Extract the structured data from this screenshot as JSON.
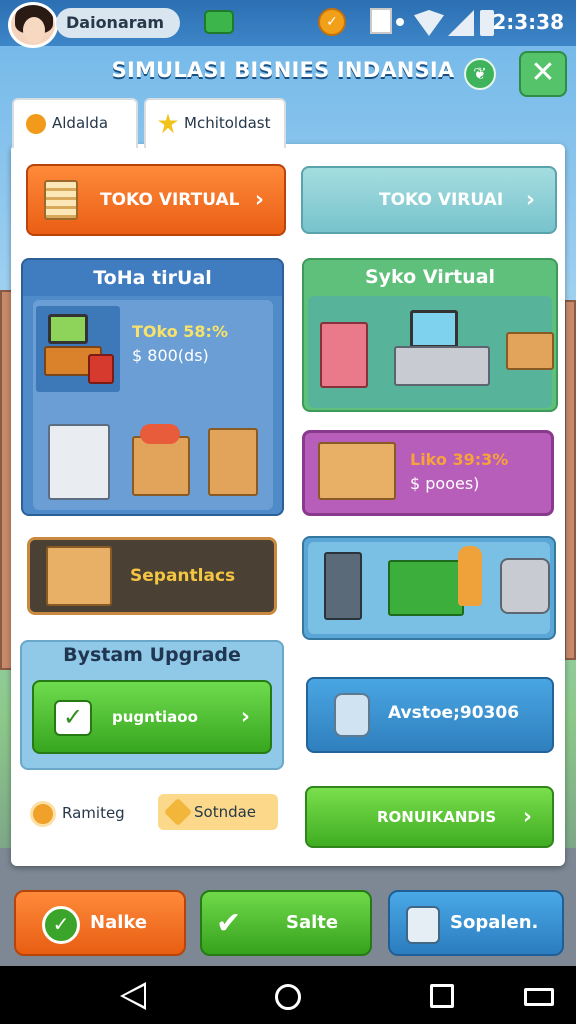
{
  "status_bar": {
    "player_name": "Daionaram",
    "time": "2:3:38"
  },
  "header": {
    "title": "SIMULASI BISNIES INDANSIA",
    "close_label": "✕"
  },
  "tabs": [
    {
      "label": "Aldalda"
    },
    {
      "label": "Mchitoldast"
    }
  ],
  "buttons": {
    "toko_virtual_primary": "TOKO VIRTUAL",
    "toko_virtual_secondary": "TOKO VIRUAI",
    "purchase": "pugntiaoo",
    "avstoe": "Avstoe;90306",
    "ranking_action": "RONUIKANDIS"
  },
  "cards": {
    "toko_tirual": {
      "title": "ToHa tirUal",
      "stat_line1": "TOko 58:%",
      "stat_line2": "$ 800(ds)"
    },
    "syko_virtual": {
      "title": "Syko Virtual"
    },
    "liko_card": {
      "stat_line1": "Liko 39:3%",
      "stat_line2": "$ pooes)"
    },
    "sepantlacs": {
      "label": "Sepantlacs"
    },
    "system_upgrade": {
      "title": "Bystam Upgrade"
    }
  },
  "footer_row": {
    "ranking_label": "Ramiteg",
    "badge_label": "Sotndae"
  },
  "actions": [
    {
      "label": "Nalke"
    },
    {
      "label": "Salte"
    },
    {
      "label": "Sopalen."
    }
  ],
  "colors": {
    "orange": "#ea5e14",
    "green": "#37a61f",
    "blue": "#2f7fbe",
    "panel_blue": "#4f8ac9",
    "panel_green": "#5ec07a",
    "panel_purple": "#b75dba"
  }
}
